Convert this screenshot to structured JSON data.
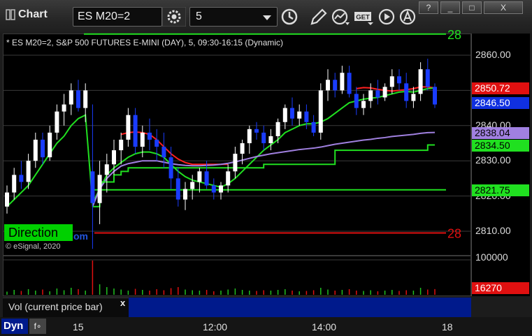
{
  "window": {
    "title": "Chart",
    "buttons": {
      "help": "?",
      "minimize": "_",
      "maximize": "□",
      "close": "X"
    }
  },
  "toolbar": {
    "symbol": "ES M20=2",
    "interval": "5",
    "icons": [
      "gear-icon",
      "clock-icon",
      "pencil-icon",
      "indicator-icon",
      "get-icon",
      "play-icon",
      "alert-icon"
    ],
    "get_label": "GET"
  },
  "chart_header": "* ES M20=2, S&P 500 FUTURES E-MINI (DAY), 5, 09:30-16:15 (Dynamic)",
  "overlay": {
    "direction_label": "Direction",
    "copyright": "© eSignal, 2020",
    "copyright_tail": "om",
    "top_right_cut": "28",
    "red_line_cut": "28"
  },
  "colors": {
    "up_candle": "#ffffff",
    "down_candle": "#1a3cff",
    "ma_red": "#ff2020",
    "ma_green": "#20e020",
    "ma_purple": "#a080e0",
    "level_green": "#20e020",
    "level_red": "#e01010",
    "tag_blue": "#1030e0"
  },
  "chart_data": {
    "type": "candlestick",
    "ylim": [
      2800,
      2870
    ],
    "y_ticks": [
      "2860.00",
      "2850.00",
      "2840.00",
      "2830.00",
      "2820.00",
      "2810.00"
    ],
    "y_tick_values": [
      2860,
      2850,
      2840,
      2830,
      2820,
      2810
    ],
    "x_ticks": [
      "15",
      "12:00",
      "14:00",
      "18"
    ],
    "price_tags": [
      {
        "label": "2850.72",
        "value": 2850.72,
        "color": "#e01010",
        "text": "#ffffff"
      },
      {
        "label": "2846.50",
        "value": 2846.5,
        "color": "#1030e0",
        "text": "#ffffff"
      },
      {
        "label": "2838.04",
        "value": 2838.04,
        "color": "#a080e0",
        "text": "#000000"
      },
      {
        "label": "2834.50",
        "value": 2834.5,
        "color": "#20e020",
        "text": "#000000"
      },
      {
        "label": "2821.75",
        "value": 2821.75,
        "color": "#20e020",
        "text": "#000000"
      }
    ],
    "levels": [
      {
        "name": "top-green",
        "value": 2866,
        "color": "#20e020"
      },
      {
        "name": "red",
        "value": 2809.5,
        "color": "#e01010"
      }
    ],
    "candles": [
      [
        2817,
        2823,
        2815,
        2821
      ],
      [
        2821,
        2828,
        2819,
        2826
      ],
      [
        2826,
        2830,
        2822,
        2824
      ],
      [
        2824,
        2832,
        2822,
        2830
      ],
      [
        2830,
        2838,
        2828,
        2836
      ],
      [
        2836,
        2838,
        2829,
        2831
      ],
      [
        2831,
        2840,
        2830,
        2838
      ],
      [
        2838,
        2846,
        2836,
        2844
      ],
      [
        2844,
        2849,
        2840,
        2846
      ],
      [
        2846,
        2852,
        2843,
        2850
      ],
      [
        2850,
        2853,
        2844,
        2845
      ],
      [
        2845,
        2852,
        2841,
        2850
      ],
      [
        2827,
        2846,
        2805,
        2818
      ],
      [
        2818,
        2830,
        2812,
        2826
      ],
      [
        2826,
        2832,
        2821,
        2829
      ],
      [
        2829,
        2836,
        2826,
        2833
      ],
      [
        2833,
        2838,
        2829,
        2836
      ],
      [
        2836,
        2845,
        2834,
        2843
      ],
      [
        2843,
        2845,
        2832,
        2834
      ],
      [
        2834,
        2840,
        2831,
        2838
      ],
      [
        2838,
        2842,
        2833,
        2836
      ],
      [
        2836,
        2839,
        2830,
        2834
      ],
      [
        2834,
        2838,
        2828,
        2831
      ],
      [
        2831,
        2834,
        2822,
        2825
      ],
      [
        2825,
        2828,
        2817,
        2819
      ],
      [
        2819,
        2824,
        2816,
        2822
      ],
      [
        2822,
        2826,
        2819,
        2824
      ],
      [
        2824,
        2828,
        2821,
        2827
      ],
      [
        2827,
        2830,
        2822,
        2823
      ],
      [
        2823,
        2825,
        2819,
        2821
      ],
      [
        2821,
        2824,
        2819,
        2823
      ],
      [
        2823,
        2829,
        2821,
        2827
      ],
      [
        2827,
        2834,
        2825,
        2832
      ],
      [
        2832,
        2836,
        2829,
        2835
      ],
      [
        2835,
        2840,
        2832,
        2839
      ],
      [
        2839,
        2841,
        2836,
        2838
      ],
      [
        2838,
        2840,
        2833,
        2835
      ],
      [
        2835,
        2839,
        2833,
        2837
      ],
      [
        2837,
        2842,
        2835,
        2841
      ],
      [
        2841,
        2846,
        2839,
        2845
      ],
      [
        2845,
        2848,
        2840,
        2842
      ],
      [
        2842,
        2846,
        2840,
        2844
      ],
      [
        2844,
        2846,
        2839,
        2841
      ],
      [
        2841,
        2843,
        2837,
        2838
      ],
      [
        2838,
        2852,
        2836,
        2850
      ],
      [
        2850,
        2856,
        2847,
        2853
      ],
      [
        2853,
        2855,
        2848,
        2850
      ],
      [
        2850,
        2857,
        2849,
        2855
      ],
      [
        2855,
        2857,
        2848,
        2849
      ],
      [
        2849,
        2851,
        2843,
        2845
      ],
      [
        2845,
        2849,
        2843,
        2847
      ],
      [
        2847,
        2852,
        2845,
        2850
      ],
      [
        2850,
        2853,
        2846,
        2848
      ],
      [
        2848,
        2852,
        2847,
        2851
      ],
      [
        2851,
        2856,
        2849,
        2854
      ],
      [
        2854,
        2856,
        2850,
        2852
      ],
      [
        2852,
        2855,
        2845,
        2847
      ],
      [
        2847,
        2851,
        2845,
        2849
      ],
      [
        2849,
        2858,
        2847,
        2856
      ],
      [
        2856,
        2859,
        2850,
        2851
      ],
      [
        2851,
        2852,
        2845,
        2846
      ]
    ],
    "series": [
      {
        "name": "",
        "color": "#ff2020",
        "values": [
          null,
          null,
          null,
          null,
          null,
          null,
          null,
          null,
          null,
          null,
          null,
          null,
          null,
          null,
          null,
          null,
          2837.5,
          2838,
          2838.2,
          2838,
          2837.5,
          2836,
          2834,
          2832,
          2830.5,
          2829.5,
          2829,
          2829,
          2829,
          2829,
          2829,
          2829,
          null,
          null,
          null,
          null,
          null,
          null,
          null,
          null,
          null,
          null,
          null,
          null,
          null,
          null,
          null,
          null,
          null,
          2850.5,
          2850.8,
          2850.7,
          2850.3,
          2850,
          2849.8,
          2850,
          2850.2,
          2850.5,
          2851,
          2851,
          2850.7
        ]
      },
      {
        "name": "",
        "color": "#20e020",
        "values": [
          2817,
          2819,
          2821,
          2823,
          2826,
          2829,
          2832,
          2835,
          2837,
          2840,
          2842,
          2843,
          2818,
          2822,
          2826,
          2828,
          2829.5,
          2831,
          2832,
          2832.5,
          2832.5,
          2832,
          2831,
          2829,
          2827,
          2825.5,
          2824.5,
          2824,
          2823.5,
          2823,
          2822.5,
          2823.5,
          2825,
          2827,
          2829,
          2831,
          2833,
          2834.5,
          2836,
          2838,
          2839,
          2840,
          2840.5,
          2840.5,
          2841,
          2842,
          2843.5,
          2845,
          2846.5,
          2847,
          2847.5,
          2847.8,
          2848,
          2848.5,
          2849,
          2849.5,
          2849.7,
          2849.5,
          2850,
          2850.5,
          2850.7
        ]
      },
      {
        "name": "",
        "color": "#a080e0",
        "values": [
          null,
          null,
          null,
          null,
          null,
          null,
          null,
          null,
          null,
          null,
          null,
          null,
          2817,
          2822,
          2825,
          2827,
          2828.5,
          2829.2,
          2829.6,
          2830,
          2830,
          2830,
          2829.6,
          2829.2,
          2828.9,
          2828.7,
          2828.6,
          2828.6,
          2828.7,
          2828.8,
          2829,
          2829.3,
          2829.7,
          2830.2,
          2830.7,
          2831.2,
          2831.6,
          2832,
          2832.3,
          2832.6,
          2832.9,
          2833.2,
          2833.4,
          2833.6,
          2833.9,
          2834.3,
          2834.7,
          2835,
          2835.3,
          2835.6,
          2835.9,
          2836.1,
          2836.4,
          2836.6,
          2836.9,
          2837.1,
          2837.3,
          2837.5,
          2837.8,
          2838,
          2838.04
        ]
      },
      {
        "name": "",
        "color": "#20e020",
        "step": true,
        "values": [
          null,
          null,
          null,
          null,
          null,
          null,
          null,
          null,
          null,
          null,
          null,
          null,
          2817,
          2824,
          2824,
          2826,
          2827,
          2828,
          2828,
          2828,
          2828,
          2828,
          2828,
          2828,
          2828,
          2828,
          2828,
          2828,
          2828,
          2828,
          2828,
          2828,
          2828,
          2828,
          2828,
          2828,
          2829,
          2829,
          2829,
          2829,
          2829,
          2829,
          2829,
          2829,
          2829,
          2829,
          2833,
          2833,
          2833,
          2833,
          2833,
          2833,
          2833,
          2833,
          2833,
          2833,
          2833,
          2833,
          2833,
          2834.5,
          2834.5
        ]
      },
      {
        "name": "",
        "color": "#20e020",
        "flat": 2821.75,
        "start": 12
      }
    ],
    "volume": {
      "ylim": [
        0,
        110000
      ],
      "ticks": [
        "100000"
      ],
      "tag": "16270",
      "values": [
        9000,
        14000,
        11000,
        16000,
        12000,
        15000,
        10000,
        18000,
        13000,
        20000,
        16000,
        12000,
        98000,
        30000,
        22000,
        18000,
        15000,
        12000,
        17000,
        14000,
        12000,
        16000,
        13000,
        19000,
        22000,
        15000,
        13000,
        12000,
        14000,
        10000,
        12000,
        15000,
        18000,
        14000,
        12000,
        11000,
        13000,
        12000,
        14000,
        16000,
        12000,
        10000,
        11000,
        13000,
        20000,
        15000,
        12000,
        14000,
        16000,
        12000,
        11000,
        13000,
        10000,
        12000,
        14000,
        11000,
        13000,
        12000,
        20000,
        15000,
        16270
      ]
    }
  },
  "volume_panel": {
    "label": "Vol (current price bar)",
    "close": "x"
  },
  "bottom": {
    "dyn": "Dyn",
    "f": "f∘"
  }
}
